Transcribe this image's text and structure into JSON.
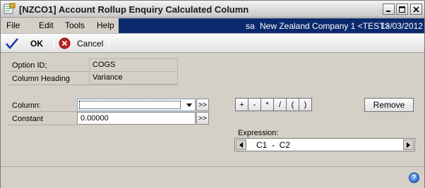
{
  "window": {
    "title": "[NZCO1] Account Rollup Enquiry Calculated Column"
  },
  "menu": {
    "items": [
      "File",
      "Edit",
      "Tools",
      "Help"
    ],
    "user": "sa",
    "company": "New Zealand Company 1 <TEST>",
    "date": "13/03/2012"
  },
  "toolbar": {
    "ok_label": "OK",
    "cancel_label": "Cancel"
  },
  "form": {
    "option_id_label": "Option ID;",
    "option_id_value": "COGS",
    "column_heading_label": "Column Heading",
    "column_heading_value": "Variance",
    "column_label": "Column:",
    "column_value": "",
    "constant_label": "Constant",
    "constant_value": "0.00000",
    "lookup_glyph": ">>"
  },
  "operators": [
    "+",
    "-",
    "*",
    "/",
    "(",
    ")"
  ],
  "remove_label": "Remove",
  "expression": {
    "label": "Expression:",
    "value": "C1  -  C2"
  },
  "colors": {
    "company_bar": "#0b2a6e",
    "ok_check": "#1a3fa8",
    "cancel_red": "#c0201e"
  }
}
